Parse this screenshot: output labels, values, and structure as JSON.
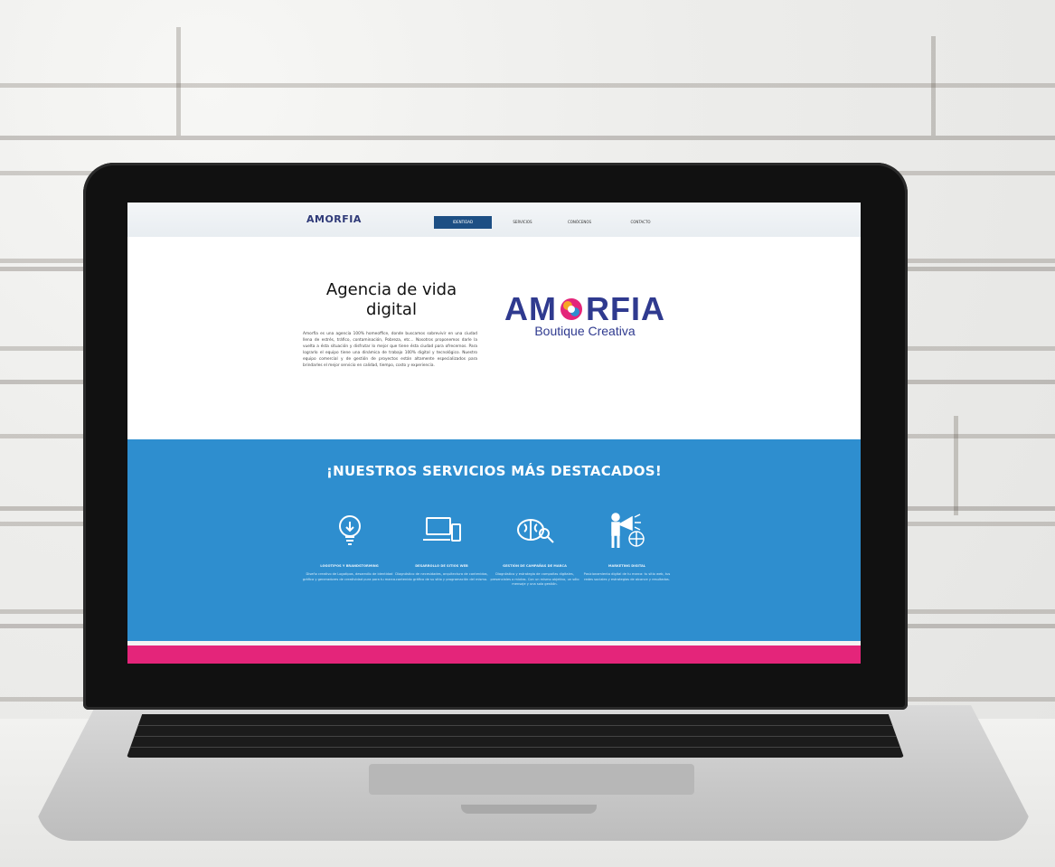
{
  "nav": {
    "logo": "AMORFIA",
    "items": [
      "IDENTIDAD",
      "SERVICIOS",
      "CONÓCENOS",
      "CONTACTO"
    ]
  },
  "hero": {
    "title": "Agencia de vida digital",
    "body": "Amorfia es una agencia 100% homeoffice, donde buscamos sobrevivir en una ciudad llena de estrés, tráfico, contaminación, Pobreza, etc... Nosotros proponemos darle la vuelta a ésta situación y disfrutar lo mejor que tiene ésta ciudad para ofrecernos. Para lograrlo el equipo tiene una dinámica de trabajo 100% digital y tecnológico. Nuestro equipo comercial y de gestión de proyectos están altamente especializados para brindarles el mejor servicio en calidad, tiempo, costo y experiencia.",
    "brand_name_left": "AM",
    "brand_name_right": "RFIA",
    "brand_sub": "Boutique Creativa"
  },
  "services": {
    "title": "¡NUESTROS SERVICIOS MÁS DESTACADOS!",
    "items": [
      {
        "icon": "lightbulb-icon",
        "title": "LOGOTIPOS Y BRANDSTORMING",
        "desc": "Diseño creativo de Logotipos, desarrollo de identidad gráfica y generadores de creatividad pura para tu marca."
      },
      {
        "icon": "devices-icon",
        "title": "DESARROLLO DE SITIOS WEB",
        "desc": "Diagnóstico de necesidades, arquitectura de contenidos, contenido gráfico de su sitio y programación del mismo."
      },
      {
        "icon": "brain-search-icon",
        "title": "GESTIÓN DE CAMPAÑAS DE MARCA",
        "desc": "Diagnóstico y estrategia de campañas digitales, presenciales o mixtas. Con un mismo objetivo, un sólo mensaje y una sola gestión."
      },
      {
        "icon": "megaphone-globe-icon",
        "title": "MARKETING DIGITAL",
        "desc": "Posicionamiento digital de tu marca: tu sitio web, tus redes sociales y estrategias de alcance y resultados."
      }
    ]
  },
  "colors": {
    "brand_navy": "#2f3a8f",
    "services_blue": "#2e8ecf",
    "accent_pink": "#e4257a",
    "nav_active": "#1d4f84"
  }
}
